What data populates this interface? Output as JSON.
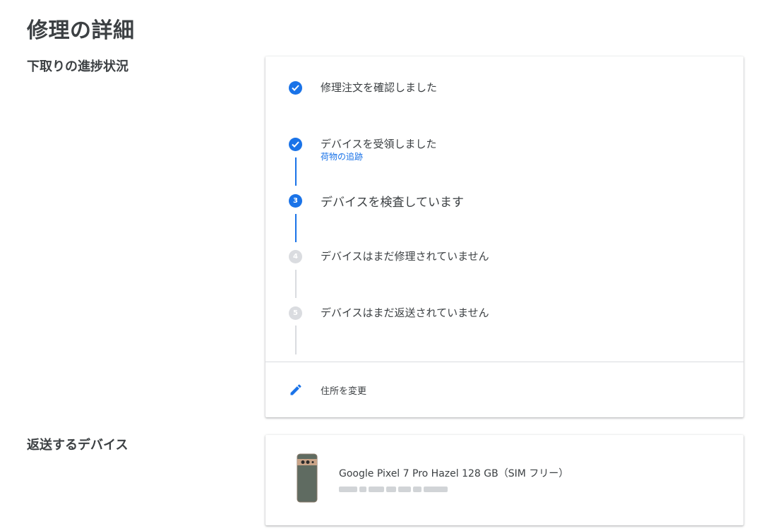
{
  "page": {
    "title": "修理の詳細"
  },
  "progress_section": {
    "label": "下取りの進捗状況",
    "steps": [
      {
        "label": "修理注文を確認しました",
        "status": "done"
      },
      {
        "label": "デバイスを受領しました",
        "status": "done",
        "link": "荷物の追跡"
      },
      {
        "label": "デバイスを検査しています",
        "status": "current",
        "number": "3"
      },
      {
        "label": "デバイスはまだ修理されていません",
        "status": "pending",
        "number": "4"
      },
      {
        "label": "デバイスはまだ返送されていません",
        "status": "pending",
        "number": "5"
      }
    ],
    "change_address": {
      "label": "住所を変更",
      "icon": "edit-pencil-icon"
    }
  },
  "return_section": {
    "label": "返送するデバイス",
    "device": {
      "name": "Google Pixel 7 Pro Hazel 128 GB（SIM フリー）",
      "image": "phone-icon"
    }
  },
  "colors": {
    "accent": "#1a73e8",
    "pending": "#dadce0",
    "text": "#3c4043"
  }
}
